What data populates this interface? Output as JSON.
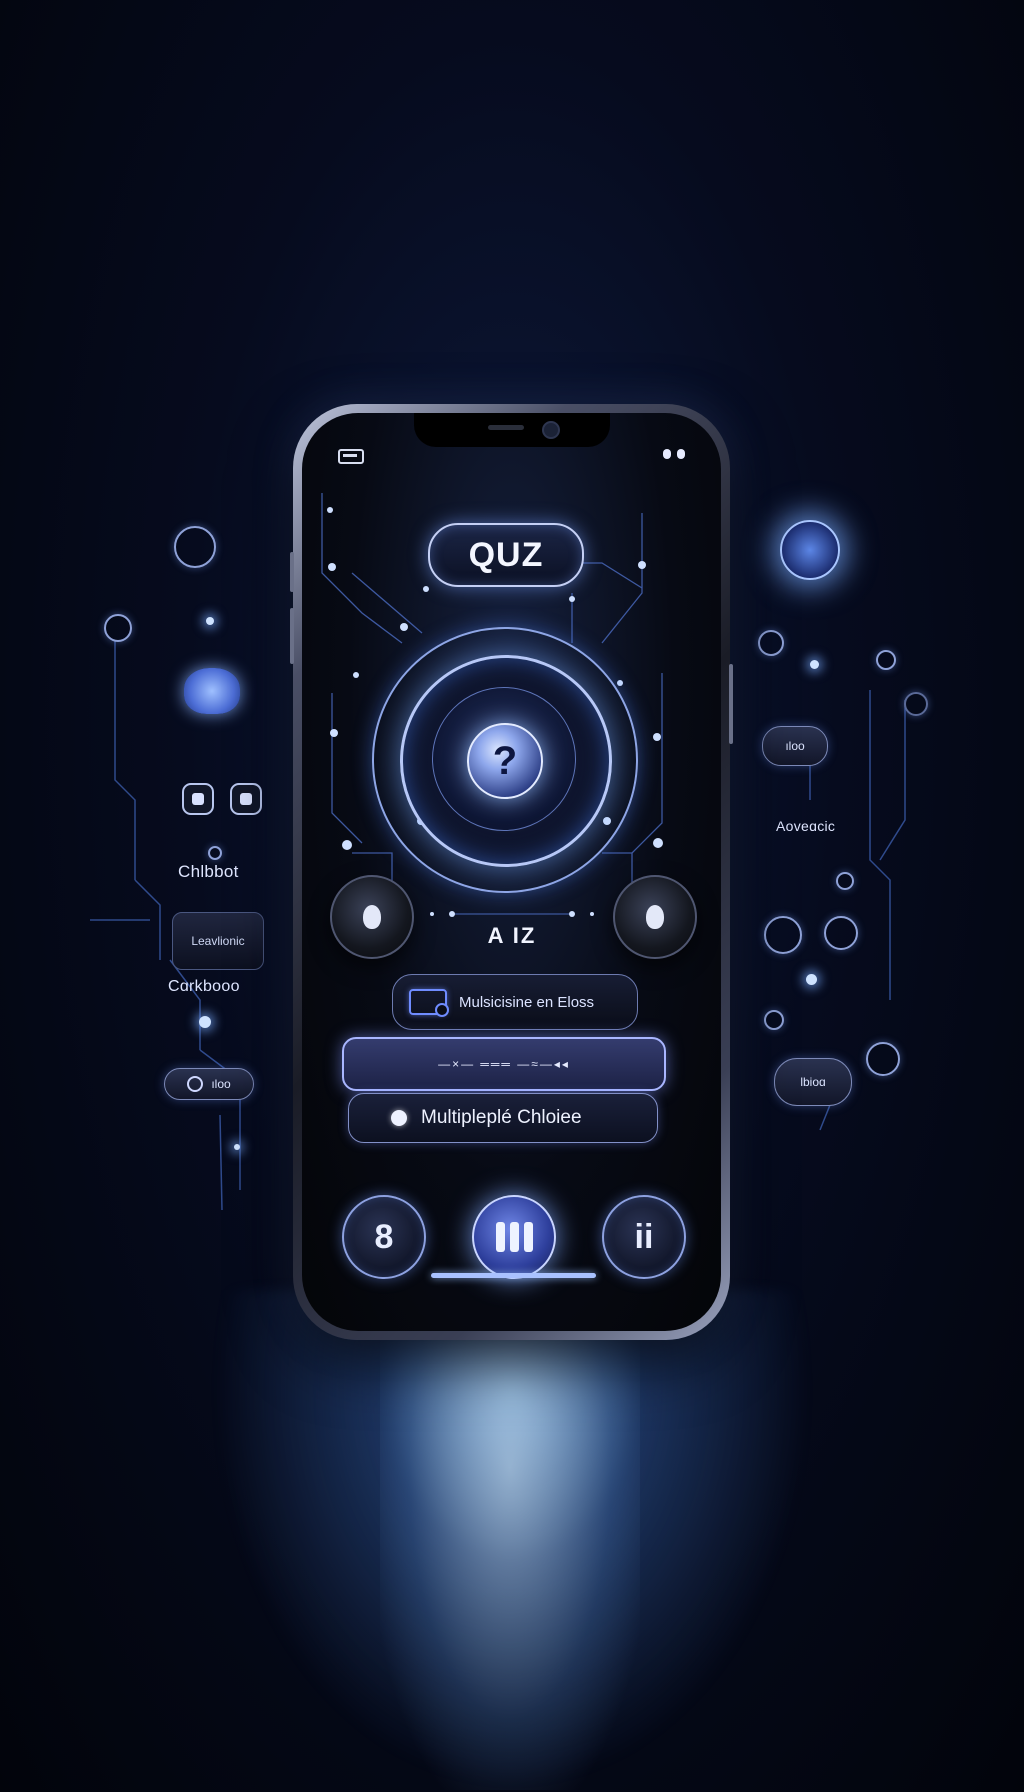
{
  "quiz_title": "QUZ",
  "question_symbol": "?",
  "section_label": "A IZ",
  "options": [
    {
      "label": "Mulsicisine en Eloss"
    },
    {
      "label": "—×— ═══ —≈—◂◂"
    },
    {
      "label": "Multipleplé Chloiee"
    }
  ],
  "nav": {
    "left_symbol": "8",
    "right_symbol": "ii"
  },
  "left_panel": {
    "chatbot_label": "Chlbbot",
    "box_label": "Leavlionic",
    "bottom_label": "Cɑrkbooo",
    "chip_label": "ıloo"
  },
  "right_panel": {
    "chip_top_label": "ıloo",
    "side_label": "Aoveɑcic",
    "chip_bottom_label": "lbioɑ"
  },
  "colors": {
    "accent": "#8ea7ec",
    "glow": "#a9c2ff",
    "background": "#060b1e"
  }
}
